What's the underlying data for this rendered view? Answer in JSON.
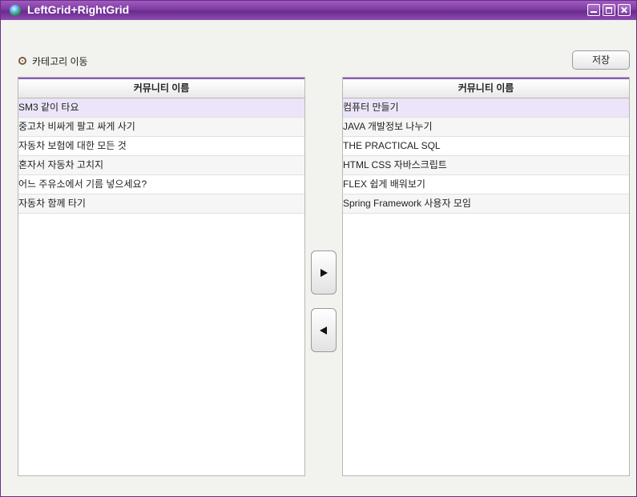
{
  "window": {
    "title": "LeftGrid+RightGrid"
  },
  "radio": {
    "label": "카테고리 이동"
  },
  "toolbar": {
    "save_label": "저장"
  },
  "left_grid": {
    "header": "커뮤니티 이름",
    "rows": [
      "SM3 같이 타요",
      "중고차 비싸게 팔고 싸게 사기",
      "자동차 보험에 대한 모든 것",
      "혼자서 자동차 고치지",
      "어느 주유소에서 기름 넣으세요?",
      "자동차 함께 타기"
    ]
  },
  "right_grid": {
    "header": "커뮤니티 이름",
    "rows": [
      "컴퓨터 만들기",
      "JAVA 개발정보 나누기",
      "THE PRACTICAL SQL",
      "HTML CSS 자바스크립트",
      "FLEX 쉽게 배워보기",
      "Spring Framework 사용자 모임"
    ]
  },
  "colors": {
    "accent": "#8a5ab8",
    "titlebar": "#7d3aa0",
    "selected_row": "#ece4f8"
  },
  "icons": {
    "app": "globe-icon",
    "move_right": "arrow-right-icon",
    "move_left": "arrow-left-icon"
  }
}
